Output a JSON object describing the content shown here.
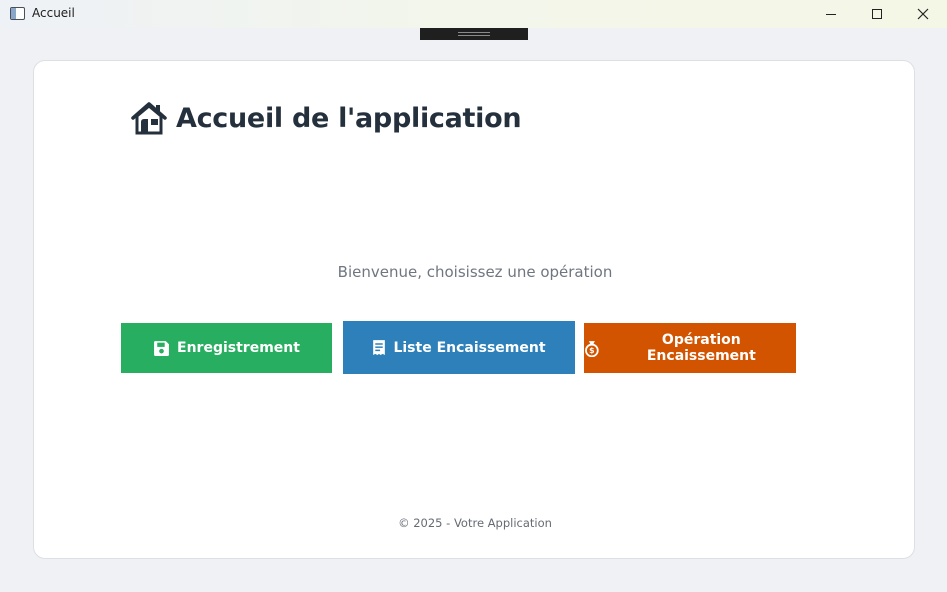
{
  "window": {
    "title": "Accueil",
    "icon": "app-window-icon"
  },
  "page": {
    "heading": "Accueil de l'application",
    "heading_icon": "home-icon",
    "welcome": "Bienvenue, choisissez une opération",
    "footer": "© 2025 - Votre Application"
  },
  "buttons": [
    {
      "label": "Enregistrement",
      "icon": "floppy-disk-icon",
      "color": "#27ae60"
    },
    {
      "label": "Liste Encaissement",
      "icon": "receipt-icon",
      "color": "#2e80ba"
    },
    {
      "label": "Opération Encaissement",
      "icon": "money-bag-icon",
      "color": "#d35400"
    }
  ],
  "colors": {
    "heading_text": "#25303d",
    "background": "#f0f1f4",
    "card": "#ffffff"
  }
}
